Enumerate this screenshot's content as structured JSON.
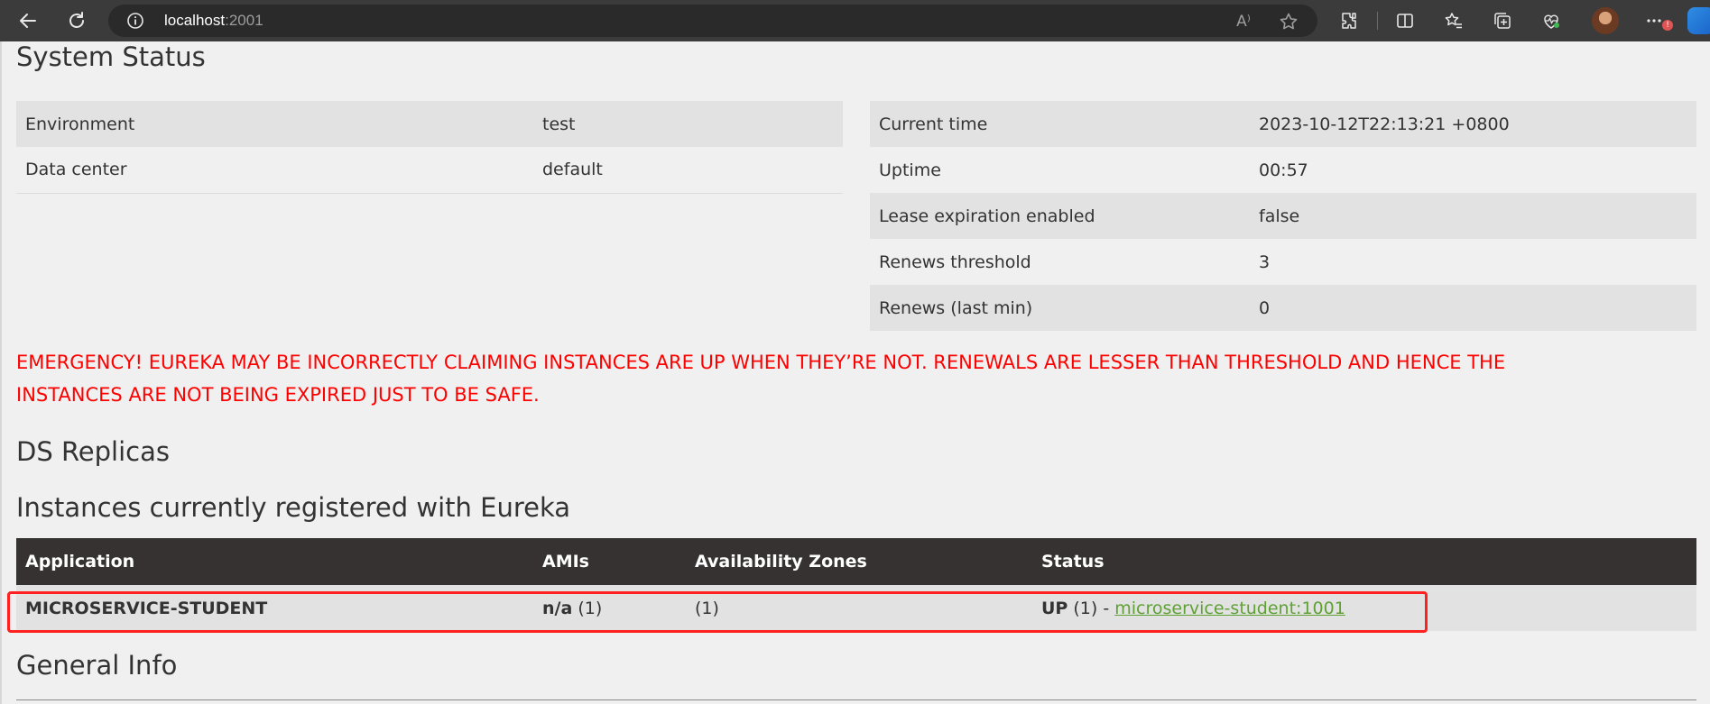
{
  "browser": {
    "url_host": "localhost",
    "url_port": ":2001",
    "read_aloud_label": "A⁾"
  },
  "page": {
    "system_status_title": "System Status",
    "env_table": [
      {
        "label": "Environment",
        "value": "test"
      },
      {
        "label": "Data center",
        "value": "default"
      }
    ],
    "status_table": [
      {
        "label": "Current time",
        "value": "2023-10-12T22:13:21 +0800"
      },
      {
        "label": "Uptime",
        "value": "00:57"
      },
      {
        "label": "Lease expiration enabled",
        "value": "false"
      },
      {
        "label": "Renews threshold",
        "value": "3"
      },
      {
        "label": "Renews (last min)",
        "value": "0"
      }
    ],
    "emergency_line1": "EMERGENCY! EUREKA MAY BE INCORRECTLY CLAIMING INSTANCES ARE UP WHEN THEY’RE NOT. RENEWALS ARE LESSER THAN THRESHOLD AND HENCE THE",
    "emergency_line2": "INSTANCES ARE NOT BEING EXPIRED JUST TO BE SAFE.",
    "ds_replicas_title": "DS Replicas",
    "instances_title": "Instances currently registered with Eureka",
    "instances_table": {
      "headers": [
        "Application",
        "AMIs",
        "Availability Zones",
        "Status"
      ],
      "rows": [
        {
          "application": "MICROSERVICE-STUDENT",
          "amis_bold": "n/a",
          "amis_count": " (1)",
          "zones": "(1)",
          "status_bold": "UP",
          "status_count": " (1) - ",
          "instance_link": "microservice-student:1001"
        }
      ]
    },
    "general_info_title": "General Info"
  },
  "colors": {
    "emergency": "#ff0000",
    "table_header_bg": "#353231",
    "link": "#5fa134",
    "highlight_box": "#ff2020"
  }
}
